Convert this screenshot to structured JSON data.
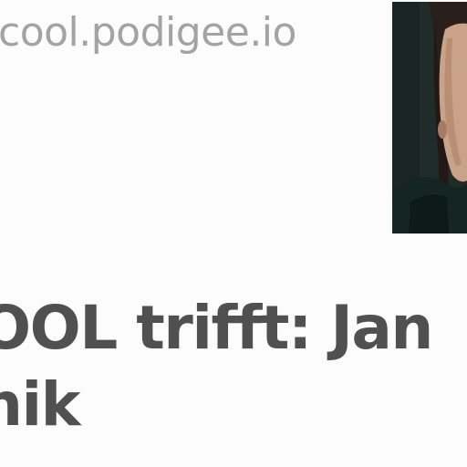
{
  "header": {
    "site_url": "cool.podigee.io"
  },
  "cover": {
    "icon": "person-photo"
  },
  "episode": {
    "title_line_1": "OOL trifft: Jan",
    "title_line_2": "nik"
  },
  "colors": {
    "background": "#fcfcfc",
    "url_text": "#a3a3a3",
    "title_text": "#505050"
  }
}
